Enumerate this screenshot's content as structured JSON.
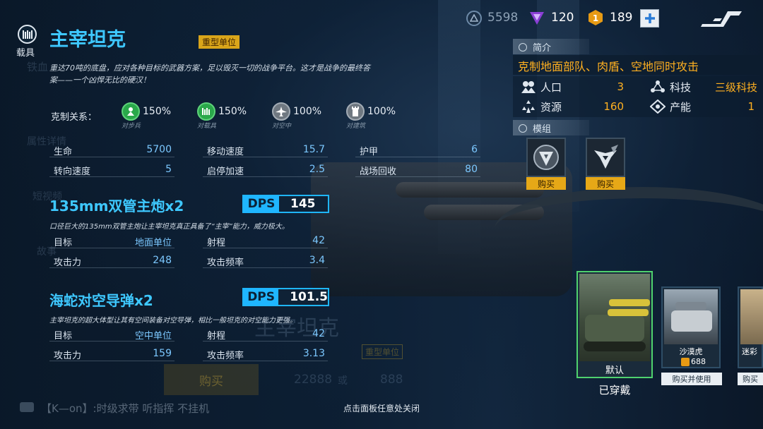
{
  "header": {
    "category_label": "载具",
    "title": "主宰坦克",
    "type_badge": "重型单位",
    "description": "重达70吨的底盘，应对各种目标的武器方案，足以毁灭一切的战争平台。这才是战争的最终答案——一个凶悍无比的硬汉！"
  },
  "currency": {
    "credits": "5598",
    "crystals": "120",
    "medals": "189",
    "add_icon": "plus-icon"
  },
  "counter": {
    "label": "克制关系：",
    "items": [
      {
        "pct": "150%",
        "target": "对步兵",
        "icon": "infantry-icon",
        "color": "#2aa84a"
      },
      {
        "pct": "150%",
        "target": "对载具",
        "icon": "vehicle-icon",
        "color": "#2aa84a"
      },
      {
        "pct": "100%",
        "target": "对空中",
        "icon": "aircraft-icon",
        "color": "#8a939c"
      },
      {
        "pct": "100%",
        "target": "对建筑",
        "icon": "building-icon",
        "color": "#8a939c"
      }
    ]
  },
  "stats": [
    {
      "label": "生命",
      "value": "5700"
    },
    {
      "label": "移动速度",
      "value": "15.7"
    },
    {
      "label": "护甲",
      "value": "6"
    },
    {
      "label": "转向速度",
      "value": "5"
    },
    {
      "label": "启停加速",
      "value": "2.5"
    },
    {
      "label": "战场回收",
      "value": "80"
    }
  ],
  "weapons": [
    {
      "name": "135mm双管主炮x2",
      "dps_label": "DPS",
      "dps": "145",
      "desc": "口径巨大的135mm双管主炮让主宰坦克真正具备了“主宰”能力，威力极大。",
      "target_label": "目标",
      "target": "地面单位",
      "range_label": "射程",
      "range": "42",
      "attack_label": "攻击力",
      "attack": "248",
      "rate_label": "攻击频率",
      "rate": "3.4"
    },
    {
      "name": "海蛇对空导弹x2",
      "dps_label": "DPS",
      "dps": "101.5",
      "desc": "主宰坦克的超大体型让其有空间装备对空导弹，相比一般坦克的对空能力更强。",
      "target_label": "目标",
      "target": "空中单位",
      "range_label": "射程",
      "range": "42",
      "attack_label": "攻击力",
      "attack": "159",
      "rate_label": "攻击频率",
      "rate": "3.13"
    }
  ],
  "intro": {
    "heading": "简介",
    "summary": "克制地面部队、肉盾、空地同时攻击",
    "attrs": [
      {
        "label": "人口",
        "value": "3",
        "icon": "population-icon"
      },
      {
        "label": "科技",
        "value": "三级科技",
        "icon": "tech-icon"
      },
      {
        "label": "资源",
        "value": "160",
        "icon": "resource-icon"
      },
      {
        "label": "产能",
        "value": "1",
        "icon": "capacity-icon"
      }
    ]
  },
  "modules": {
    "heading": "模组",
    "items": [
      {
        "icon": "module-shield-icon",
        "buy_label": "购买"
      },
      {
        "icon": "module-wing-icon",
        "buy_label": "购买"
      }
    ]
  },
  "skins": {
    "selected": {
      "name": "默认",
      "status": "已穿戴"
    },
    "items": [
      {
        "name": "沙漠虎",
        "price": "688",
        "action": "购买并使用"
      },
      {
        "name": "迷彩",
        "action": "购买"
      }
    ]
  },
  "background": {
    "left_ghost_labels": [
      "铁血",
      "属性详情",
      "短视频",
      "故事"
    ],
    "ghost_buy": "购买",
    "ghost_price_a": "22888",
    "ghost_or": "或",
    "ghost_price_b": "888",
    "ghost_title": "主宰坦克",
    "ghost_badge": "重型单位"
  },
  "chat": {
    "message": "【K—on】:时级求带  听指挥  不挂机"
  },
  "footer_hint": "点击面板任意处关闭"
}
